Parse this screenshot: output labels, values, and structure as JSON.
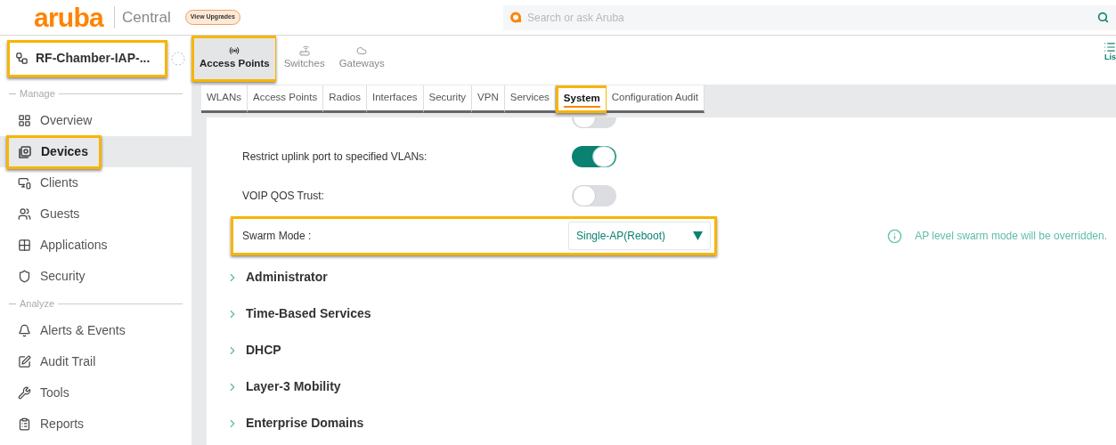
{
  "header": {
    "logo": "aruba",
    "product": "Central",
    "upgrade_badge": "View Upgrades",
    "search": {
      "placeholder": "Search or ask Aruba"
    }
  },
  "device_selector": {
    "label": "RF-Chamber-IAP-...",
    "highlighted": true
  },
  "sidebar": {
    "sections": [
      {
        "title": "Manage",
        "items": [
          {
            "label": "Overview",
            "selected": false,
            "highlighted": false
          },
          {
            "label": "Devices",
            "selected": true,
            "highlighted": true
          },
          {
            "label": "Clients",
            "selected": false,
            "highlighted": false
          },
          {
            "label": "Guests",
            "selected": false,
            "highlighted": false
          },
          {
            "label": "Applications",
            "selected": false,
            "highlighted": false
          },
          {
            "label": "Security",
            "selected": false,
            "highlighted": false
          }
        ]
      },
      {
        "title": "Analyze",
        "items": [
          {
            "label": "Alerts & Events",
            "selected": false,
            "highlighted": false
          },
          {
            "label": "Audit Trail",
            "selected": false,
            "highlighted": false
          },
          {
            "label": "Tools",
            "selected": false,
            "highlighted": false
          },
          {
            "label": "Reports",
            "selected": false,
            "highlighted": false
          }
        ]
      }
    ]
  },
  "device_tabs": [
    {
      "label": "Access Points",
      "selected": true,
      "highlighted": true
    },
    {
      "label": "Switches",
      "selected": false,
      "highlighted": false
    },
    {
      "label": "Gateways",
      "selected": false,
      "highlighted": false
    }
  ],
  "view_toggle": {
    "label": "Lis"
  },
  "config_tabs": [
    {
      "label": "WLANs",
      "selected": false,
      "highlighted": false
    },
    {
      "label": "Access Points",
      "selected": false,
      "highlighted": false
    },
    {
      "label": "Radios",
      "selected": false,
      "highlighted": false
    },
    {
      "label": "Interfaces",
      "selected": false,
      "highlighted": false
    },
    {
      "label": "Security",
      "selected": false,
      "highlighted": false
    },
    {
      "label": "VPN",
      "selected": false,
      "highlighted": false
    },
    {
      "label": "Services",
      "selected": false,
      "highlighted": false
    },
    {
      "label": "System",
      "selected": true,
      "highlighted": true
    },
    {
      "label": "Configuration Audit",
      "selected": false,
      "highlighted": false
    }
  ],
  "settings": [
    {
      "kind": "toggle",
      "on": false
    },
    {
      "kind": "toggle",
      "label": "Restrict uplink port to specified VLANs:",
      "on": true
    },
    {
      "kind": "toggle",
      "label": "VOIP QOS Trust:",
      "on": false
    },
    {
      "kind": "select",
      "label": "Swarm Mode :",
      "value": "Single-AP(Reboot)",
      "highlighted": true,
      "note": "AP level swarm mode will be overridden."
    }
  ],
  "sections": [
    {
      "label": "Administrator",
      "expanded": false
    },
    {
      "label": "Time-Based Services",
      "expanded": false
    },
    {
      "label": "DHCP",
      "expanded": false
    },
    {
      "label": "Layer-3 Mobility",
      "expanded": false
    },
    {
      "label": "Enterprise Domains",
      "expanded": false
    }
  ]
}
